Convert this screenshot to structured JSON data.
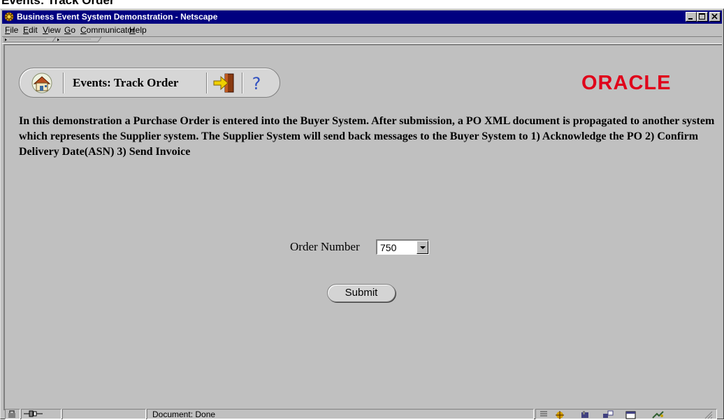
{
  "caption": "Events: Track Order",
  "window": {
    "title": "Business Event System Demonstration - Netscape",
    "controls": [
      "minimize-icon",
      "maximize-icon",
      "close-icon"
    ]
  },
  "menubar": {
    "items": [
      {
        "label": "File"
      },
      {
        "label": "Edit"
      },
      {
        "label": "View"
      },
      {
        "label": "Go"
      },
      {
        "label": "Communicator"
      },
      {
        "label": "Help"
      }
    ]
  },
  "toolbar": {
    "title": "Events: Track Order",
    "icons": [
      "home-icon",
      "exit-door-icon",
      "help-icon"
    ]
  },
  "brand": {
    "logo_text": "ORACLE",
    "color": "#e0001a"
  },
  "intro_text": "In this demonstration a Purchase Order is entered into the Buyer System. After submission, a PO XML document is propagated to another system which represents the Supplier system. The Supplier System will send back messages to the Buyer System to 1) Acknowledge the PO 2) Confirm Delivery Date(ASN) 3) Send Invoice",
  "form": {
    "order_label": "Order Number",
    "order_value": "750",
    "submit_label": "Submit"
  },
  "statusbar": {
    "text": "Document: Done",
    "icons": [
      "security-lock-icon",
      "connection-icon",
      "navigator-icon",
      "mail-icon",
      "discussion-icon",
      "composer-icon",
      "signal-icon"
    ]
  }
}
